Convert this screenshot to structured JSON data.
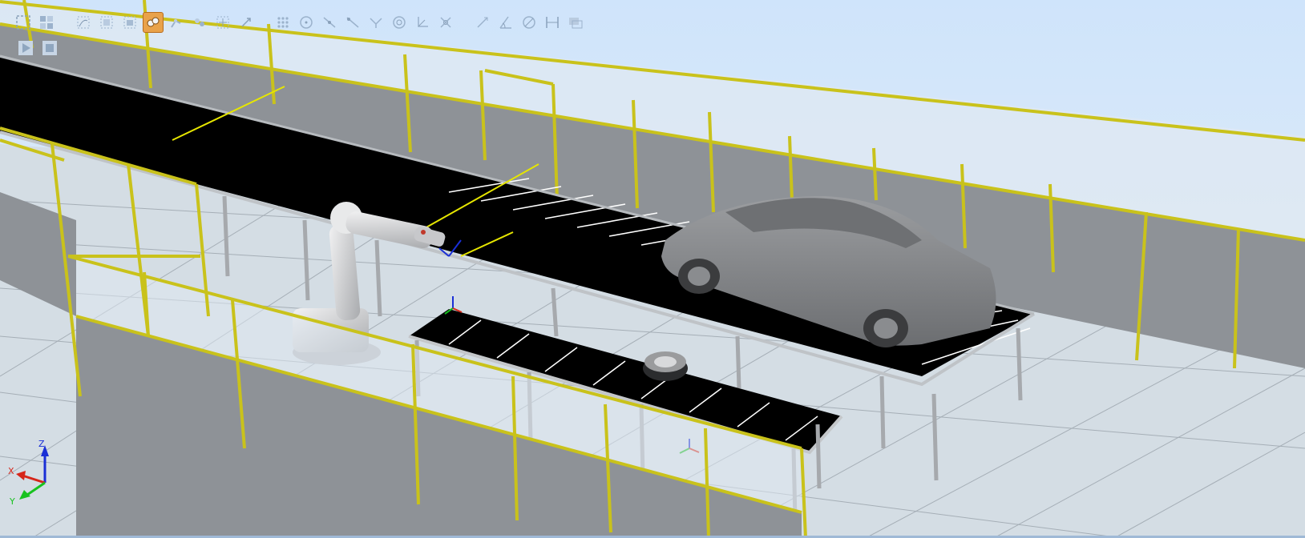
{
  "viewport": {
    "axis_labels": {
      "x": "X",
      "y": "Y",
      "z": "Z"
    },
    "colors": {
      "fence": "#c9c21b",
      "panel": "#8e9297",
      "conveyor_belt": "#000000",
      "roller": "#ffffff",
      "car": "#858789",
      "robot": "#d7d8da",
      "floor_grid": "#9aa3ab",
      "active_tool": "#e9a24a"
    }
  },
  "toolbar": {
    "groups": [
      [
        "selection-box-icon",
        "selection-filter-icon"
      ],
      [
        "select-curve-icon",
        "select-surface-icon",
        "select-body-icon",
        "select-part-icon",
        "select-mechanism-icon",
        "select-group-icon",
        "select-target-icon",
        "select-frame-icon"
      ],
      [
        "snap-grid-icon",
        "snap-center-icon",
        "snap-midpoint-icon",
        "snap-edge-icon",
        "snap-end-icon",
        "snap-gravity-icon",
        "snap-local-origin-icon",
        "snap-object-icon"
      ],
      [
        "measure-distance-icon",
        "measure-angle-icon",
        "measure-diameter-icon",
        "measure-minimum-icon",
        "measure-view-icon"
      ]
    ],
    "active": "select-part-icon"
  },
  "simulation": {
    "buttons": [
      "play-icon",
      "stop-icon"
    ]
  }
}
